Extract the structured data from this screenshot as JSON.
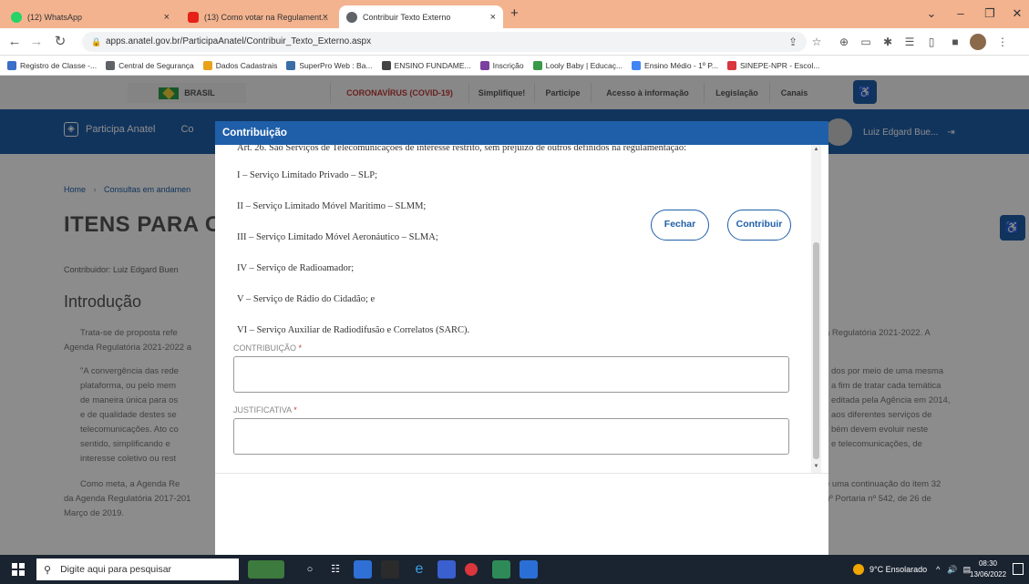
{
  "browser": {
    "tabs": [
      {
        "title": "(12) WhatsApp",
        "color": "#25d366"
      },
      {
        "title": "(13) Como votar na Regulament...",
        "color": "#e62117"
      },
      {
        "title": "Contribuir Texto Externo",
        "color": "#5f6368"
      }
    ],
    "new_tab": "+",
    "url": "apps.anatel.gov.br/ParticipaAnatel/Contribuir_Texto_Externo.aspx",
    "bookmarks": [
      {
        "label": "Registro de Classe -...",
        "color": "#3b6dc9"
      },
      {
        "label": "Central de Segurança",
        "color": "#5f6368"
      },
      {
        "label": "Dados Cadastrais",
        "color": "#e8a21a"
      },
      {
        "label": "SuperPro Web : Ba...",
        "color": "#3a6ea5"
      },
      {
        "label": "ENSINO FUNDAME...",
        "color": "#444"
      },
      {
        "label": "Inscrição",
        "color": "#7b3fa0"
      },
      {
        "label": "Looly Baby | Educaç...",
        "color": "#3a9a4a"
      },
      {
        "label": "Ensino Médio - 1º P...",
        "color": "#4285f4"
      },
      {
        "label": "SINEPE-NPR - Escol...",
        "color": "#d9363e"
      }
    ]
  },
  "gov": {
    "brasil": "BRASIL",
    "links": [
      "CORONAVÍRUS (COVID-19)",
      "Simplifique!",
      "Participe",
      "Acesso à informação",
      "Legislação",
      "Canais"
    ]
  },
  "header": {
    "app_name": "Participa Anatel",
    "nav_fragment": "Co",
    "user": "Luiz Edgard Bue..."
  },
  "background": {
    "breadcrumb_home": "Home",
    "breadcrumb_sep": "›",
    "breadcrumb_current": "Consultas em andamen",
    "title": "ITENS PARA CO",
    "contributor": "Contribuidor: Luiz Edgard Buen",
    "intro_heading": "Introdução",
    "left_lines": [
      "Trata-se de proposta refe",
      "Agenda Regulatória 2021-2022 a",
      "\"A convergência das rede",
      "plataforma, ou pelo mem",
      "de maneira única para os",
      "e de qualidade destes se",
      "telecomunicações. Ato co",
      "sentido, simplificando e",
      "interesse coletivo ou rest",
      "Como meta, a Agenda Re",
      "da Agenda Regulatória 2017-201",
      "Março de 2019."
    ],
    "right_lines": [
      "a Regulatória 2021-2022. A",
      "dos por meio de uma mesma",
      "a fim de tratar cada temática",
      "editada pela Agência em 2014,",
      "aos diferentes serviços de",
      "bém devem evoluir neste",
      "e telecomunicações, de",
      "é uma continuação do item 32",
      "nº Portaria nº 542, de 26 de"
    ]
  },
  "modal": {
    "title": "Contribuição",
    "lines": [
      "Art. 26. São Serviços de Telecomunicações de interesse restrito, sem prejuízo de outros definidos na regulamentação:",
      "I – Serviço Limitado Privado – SLP;",
      "II – Serviço Limitado Móvel Marítimo – SLMM;",
      "III – Serviço Limitado Móvel Aeronáutico – SLMA;",
      "IV – Serviço de Radioamador;",
      "V – Serviço de Rádio do Cidadão; e",
      "VI – Serviço Auxiliar de Radiodifusão e Correlatos (SARC)."
    ],
    "contribuicao_label": "CONTRIBUIÇÃO",
    "justificativa_label": "JUSTIFICATIVA",
    "required_mark": "*",
    "close_button": "Fechar",
    "submit_button": "Contribuir"
  },
  "taskbar": {
    "search_placeholder": "Digite aqui para pesquisar",
    "weather": "9°C Ensolarado",
    "time": "08:30",
    "date": "13/06/2022"
  }
}
